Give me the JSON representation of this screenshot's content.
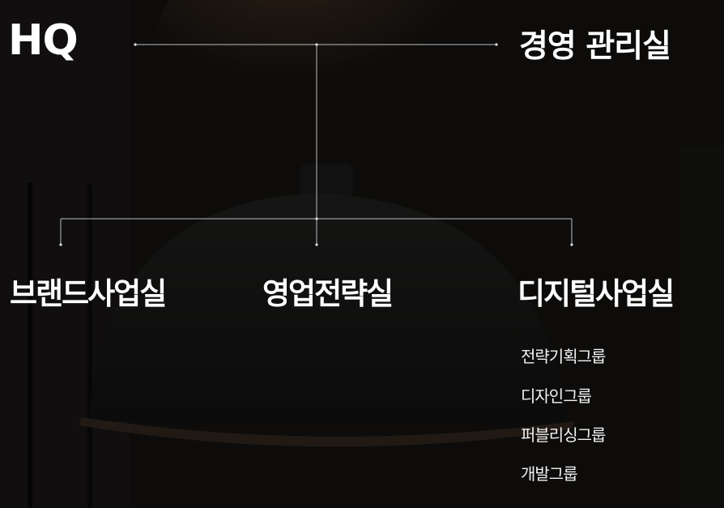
{
  "logo": {
    "text": "HQ"
  },
  "top_node": {
    "label": "경영 관리실"
  },
  "divisions": [
    {
      "label": "브랜드사업실"
    },
    {
      "label": "영업전략실"
    },
    {
      "label": "디지털사업실"
    }
  ],
  "digital_groups": [
    {
      "label": "전략기획그룹"
    },
    {
      "label": "디자인그룹"
    },
    {
      "label": "퍼블리싱그룹"
    },
    {
      "label": "개발그룹"
    }
  ],
  "colors": {
    "background": "#0d0c0b",
    "text": "#ffffff",
    "connector": "#bdbdbd",
    "lamp_glow": "#2a1d12"
  }
}
